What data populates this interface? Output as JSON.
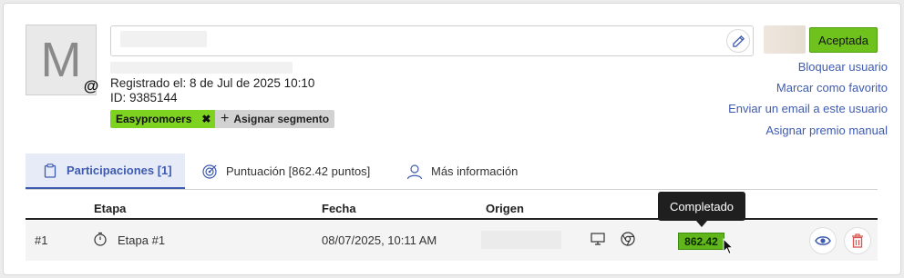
{
  "user": {
    "avatar_letter": "M",
    "registered_text": "Registrado el: 8 de Jul de 2025 10:10",
    "id_text": "ID: 9385144",
    "status_label": "Aceptada",
    "segment_tag": "Easypromoers",
    "assign_segment_label": "Asignar segmento"
  },
  "actions": [
    "Bloquear usuario",
    "Marcar como favorito",
    "Enviar un email a este usuario",
    "Asignar premio manual"
  ],
  "tabs": [
    {
      "label": "Participaciones [1]",
      "icon": "clipboard-icon",
      "active": true
    },
    {
      "label": "Puntuación [862.42 puntos]",
      "icon": "target-icon",
      "active": false
    },
    {
      "label": "Más información",
      "icon": "user-icon",
      "active": false
    }
  ],
  "table": {
    "headers": [
      "Etapa",
      "Fecha",
      "Origen"
    ],
    "rows": [
      {
        "index": "#1",
        "stage": "Etapa #1",
        "date": "08/07/2025, 10:11 AM",
        "score": "862.42"
      }
    ]
  },
  "tooltip": "Completado",
  "colors": {
    "accent": "#3f5bb0",
    "status_green": "#6fc21c",
    "delete_red": "#d9534f"
  }
}
